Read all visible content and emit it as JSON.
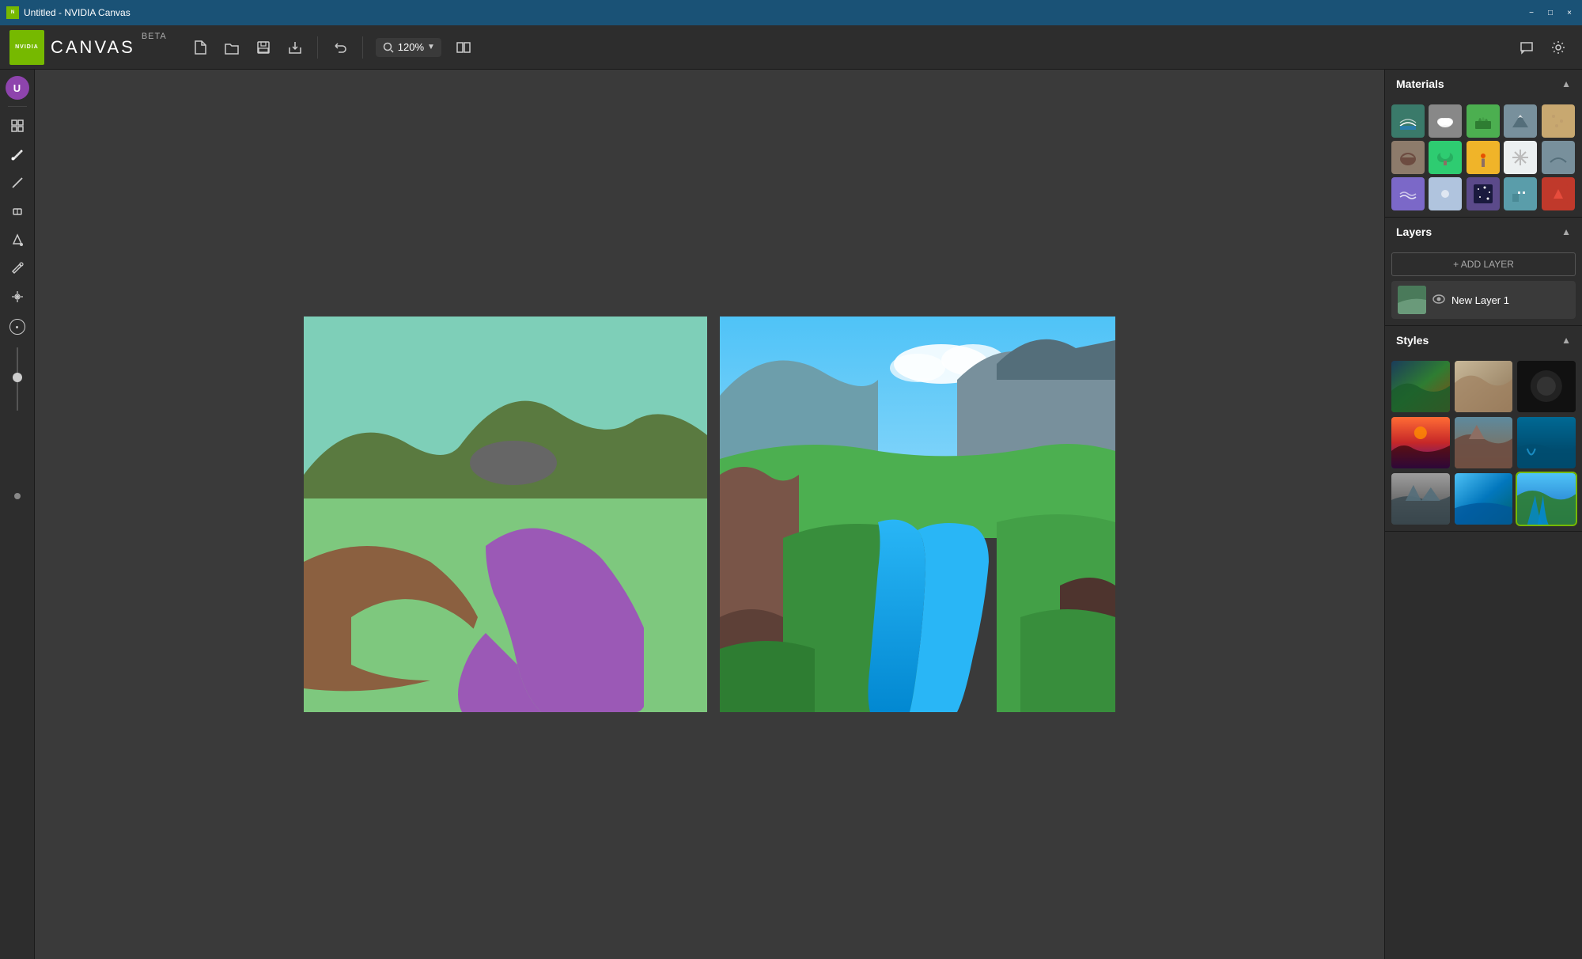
{
  "window": {
    "title": "Untitled - NVIDIA Canvas"
  },
  "titlebar": {
    "title": "Untitled - NVIDIA Canvas",
    "minimize_label": "−",
    "maximize_label": "□",
    "close_label": "×"
  },
  "toolbar": {
    "app_title": "CANVAS",
    "app_beta": "BETA",
    "zoom_value": "120%",
    "new_label": "new",
    "open_label": "open",
    "save_label": "save",
    "export_label": "export",
    "undo_label": "undo",
    "zoom_label": "zoom",
    "compare_label": "compare",
    "feedback_label": "feedback",
    "settings_label": "settings"
  },
  "left_toolbar": {
    "tools": [
      {
        "name": "grid",
        "icon": "⊞",
        "label": "Grid"
      },
      {
        "name": "brush",
        "icon": "✏",
        "label": "Brush"
      },
      {
        "name": "line",
        "icon": "/",
        "label": "Line"
      },
      {
        "name": "eraser",
        "icon": "◻",
        "label": "Eraser"
      },
      {
        "name": "fill",
        "icon": "▼",
        "label": "Fill"
      },
      {
        "name": "eyedropper",
        "icon": "💉",
        "label": "Eyedropper"
      },
      {
        "name": "pan",
        "icon": "✋",
        "label": "Pan"
      }
    ],
    "brush_size_value": "0.5"
  },
  "materials": {
    "section_title": "Materials",
    "items": [
      {
        "name": "water-reflection",
        "color": "#3a7a6a",
        "label": "Water Reflection"
      },
      {
        "name": "cloud",
        "color": "#888888",
        "label": "Cloud"
      },
      {
        "name": "grass",
        "color": "#5cb85c",
        "label": "Grass"
      },
      {
        "name": "mountain",
        "color": "#7f8c8d",
        "label": "Mountain"
      },
      {
        "name": "sand",
        "color": "#c8a870",
        "label": "Sand"
      },
      {
        "name": "rock",
        "color": "#8d7b6b",
        "label": "Rock"
      },
      {
        "name": "bush",
        "color": "#3aaa60",
        "label": "Bush"
      },
      {
        "name": "palm-tree",
        "color": "#e6b800",
        "label": "Palm Tree"
      },
      {
        "name": "snow",
        "color": "#dce8f0",
        "label": "Snow"
      },
      {
        "name": "tundra",
        "color": "#aab7c4",
        "label": "Tundra"
      },
      {
        "name": "water",
        "color": "#7b68c8",
        "label": "Water"
      },
      {
        "name": "sky",
        "color": "#a0b8d0",
        "label": "Sky"
      },
      {
        "name": "stars",
        "color": "#8060b8",
        "label": "Stars"
      },
      {
        "name": "building",
        "color": "#5dade2",
        "label": "Building"
      },
      {
        "name": "red-material",
        "color": "#c0392b",
        "label": "Red Material"
      }
    ]
  },
  "layers": {
    "section_title": "Layers",
    "add_layer_label": "+ ADD LAYER",
    "items": [
      {
        "name": "new-layer-1",
        "label": "New Layer 1",
        "visible": true
      }
    ]
  },
  "styles": {
    "section_title": "Styles",
    "items": [
      {
        "name": "style-landscape-1",
        "label": "Mountain landscape"
      },
      {
        "name": "style-desert",
        "label": "Desert"
      },
      {
        "name": "style-dark",
        "label": "Dark"
      },
      {
        "name": "style-sunset",
        "label": "Sunset mountains"
      },
      {
        "name": "style-canyon",
        "label": "Canyon"
      },
      {
        "name": "style-ocean",
        "label": "Ocean"
      },
      {
        "name": "style-foggy",
        "label": "Foggy mountains"
      },
      {
        "name": "style-coastal",
        "label": "Coastal"
      },
      {
        "name": "style-forest",
        "label": "Forest lake",
        "selected": true
      }
    ]
  }
}
